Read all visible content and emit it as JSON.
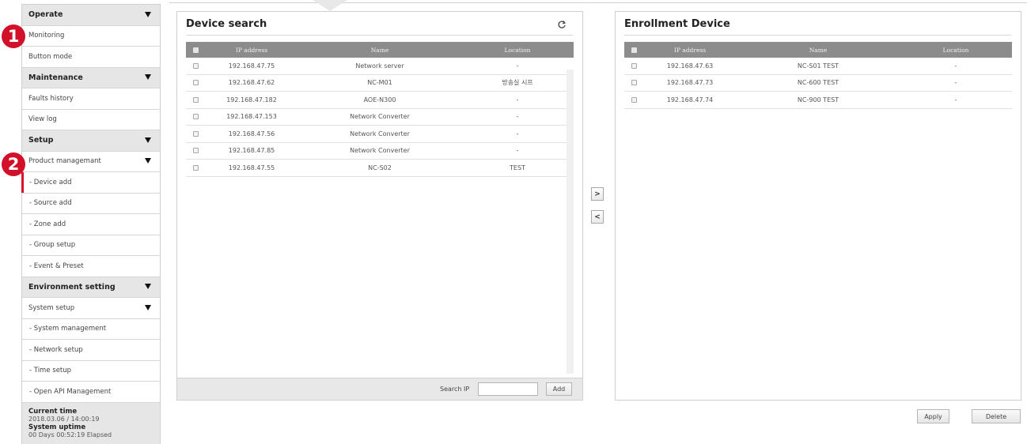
{
  "sidebar": {
    "items": [
      {
        "label": "Operate",
        "type": "header",
        "caret": true
      },
      {
        "label": "Monitoring",
        "type": "item"
      },
      {
        "label": "Button mode",
        "type": "item"
      },
      {
        "label": "Maintenance",
        "type": "header",
        "caret": true
      },
      {
        "label": "Faults history",
        "type": "item"
      },
      {
        "label": "View log",
        "type": "item"
      },
      {
        "label": "Setup",
        "type": "header",
        "caret": true
      },
      {
        "label": "Product managemant",
        "type": "item",
        "caret": true
      },
      {
        "label": "- Device add",
        "type": "sub",
        "selected": true
      },
      {
        "label": "- Source add",
        "type": "sub"
      },
      {
        "label": "- Zone add",
        "type": "sub"
      },
      {
        "label": "- Group setup",
        "type": "sub"
      },
      {
        "label": "- Event & Preset",
        "type": "sub"
      },
      {
        "label": "Environment setting",
        "type": "header",
        "caret": true
      },
      {
        "label": "System setup",
        "type": "item",
        "caret": true
      },
      {
        "label": "- System management",
        "type": "sub"
      },
      {
        "label": "- Network setup",
        "type": "sub"
      },
      {
        "label": "- Time setup",
        "type": "sub"
      },
      {
        "label": "- Open API Management",
        "type": "sub"
      }
    ],
    "footer": {
      "current_time_label": "Current time",
      "current_time": "2018.03.06 / 14:00:19",
      "uptime_label": "System uptime",
      "uptime": "00 Days 00:52:19 Elapsed"
    }
  },
  "badges": {
    "one": "1",
    "two": "2"
  },
  "colors": {
    "accent": "#d3102a",
    "table_header": "#8c8c8c",
    "sidebar_header": "#e6e6e6"
  },
  "device_search": {
    "title": "Device search",
    "refresh_icon": "refresh-icon",
    "columns": {
      "ip": "IP address",
      "name": "Name",
      "location": "Location"
    },
    "rows": [
      {
        "ip": "192.168.47.75",
        "name": "Network server",
        "location": "-"
      },
      {
        "ip": "192.168.47.62",
        "name": "NC-M01",
        "location": "방송실 시프"
      },
      {
        "ip": "192.168.47.182",
        "name": "AOE-N300",
        "location": "-"
      },
      {
        "ip": "192.168.47.153",
        "name": "Network Converter",
        "location": "-"
      },
      {
        "ip": "192.168.47.56",
        "name": "Network Converter",
        "location": "-"
      },
      {
        "ip": "192.168.47.85",
        "name": "Network Converter",
        "location": "-"
      },
      {
        "ip": "192.168.47.55",
        "name": "NC-S02",
        "location": "TEST"
      }
    ],
    "search_label": "Search IP",
    "search_value": "",
    "add_label": "Add"
  },
  "enrollment": {
    "title": "Enrollment Device",
    "columns": {
      "ip": "IP address",
      "name": "Name",
      "location": "Location"
    },
    "rows": [
      {
        "ip": "192.168.47.63",
        "name": "NC-S01 TEST",
        "location": "-"
      },
      {
        "ip": "192.168.47.73",
        "name": "NC-600 TEST",
        "location": "-"
      },
      {
        "ip": "192.168.47.74",
        "name": "NC-900 TEST",
        "location": "-"
      }
    ]
  },
  "transfer": {
    "right": ">",
    "left": "<"
  },
  "actions": {
    "apply": "Apply",
    "delete": "Delete"
  }
}
